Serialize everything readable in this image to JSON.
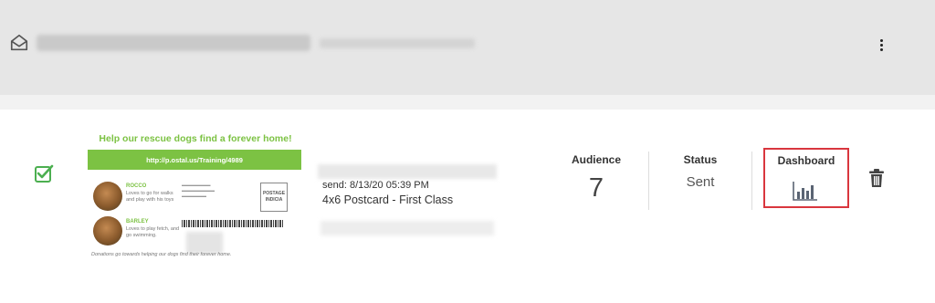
{
  "header": {
    "envelope_icon": "envelope-open-icon",
    "menu_icon": "kebab-menu-icon"
  },
  "item": {
    "checkbox_checked": true,
    "checkbox_color": "#4caf50",
    "postcard": {
      "title": "Help our rescue dogs find a forever home!",
      "url": "http://p.ostal.us/Training/4989",
      "dog1_name": "ROCCO",
      "dog1_desc": "Loves to go for walks and play with his toys",
      "dog2_name": "BARLEY",
      "dog2_desc": "Loves to play fetch, and go swimming.",
      "postage": "POSTAGE INDICIA",
      "footer": "Donations go towards helping our dogs find their forever home."
    },
    "send_info": "send: 8/13/20 05:39 PM",
    "product": "4x6 Postcard - First Class",
    "audience_label": "Audience",
    "audience_value": "7",
    "status_label": "Status",
    "status_value": "Sent",
    "dashboard_label": "Dashboard",
    "dashboard_icon": "bar-chart-icon",
    "highlight_color": "#d9363e",
    "delete_icon": "trash-icon"
  }
}
